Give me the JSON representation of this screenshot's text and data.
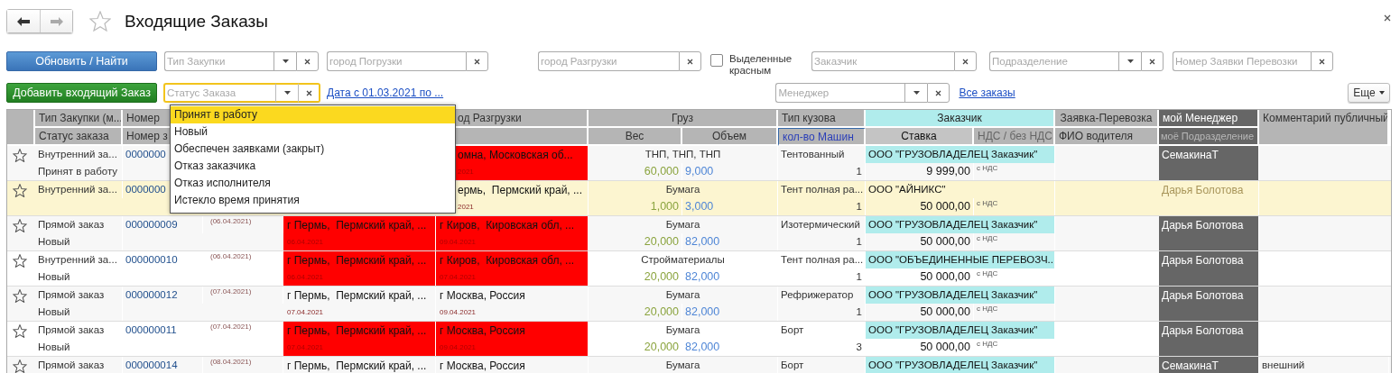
{
  "window": {
    "title": "Входящие Заказы"
  },
  "toolbar": {
    "refresh_button": "Обновить / Найти",
    "add_button": "Добавить входящий Заказ",
    "more_button": "Еще"
  },
  "filters": [
    {
      "kind": "combo",
      "placeholder": "Тип Закупки"
    },
    {
      "kind": "text",
      "placeholder": "город Погрузки"
    },
    {
      "kind": "text",
      "placeholder": "город Разгрузки"
    },
    {
      "kind": "checkbox",
      "label": "Выделенные красным",
      "checked": false
    },
    {
      "kind": "text",
      "placeholder": "Заказчик"
    },
    {
      "kind": "combo",
      "placeholder": "Подразделение"
    },
    {
      "kind": "text",
      "placeholder": "Номер Заявки Перевозки"
    }
  ],
  "status_filter": {
    "placeholder": "Статус Заказа",
    "focused": true
  },
  "date_link": "Дата с 01.03.2021 по ...",
  "manager_filter": {
    "placeholder": "Менеджер"
  },
  "all_orders_link": "Все заказы",
  "status_dropdown": {
    "open": true,
    "options": [
      {
        "label": "Принят в работу",
        "selected": true
      },
      {
        "label": "Новый",
        "selected": false
      },
      {
        "label": "Обеспечен заявками (закрыт)",
        "selected": false
      },
      {
        "label": "Отказ заказчика",
        "selected": false
      },
      {
        "label": "Отказ исполнителя",
        "selected": false
      },
      {
        "label": "Истекло время принятия",
        "selected": false
      }
    ]
  },
  "table": {
    "header_row_1": [
      "Тип Закупки (м...",
      "Номер",
      "од Разгрузки",
      "Груз",
      "Тип кузова",
      "Заказчик",
      "Заявка-Перевозка",
      "мой Менеджер",
      "Комментарий публичный"
    ],
    "header_row_2": [
      "Статус заказа",
      "Номер з",
      "Вес",
      "Объем",
      "кол-во Машин",
      "Ставка",
      "НДС / без НДС",
      "ФИО водителя",
      "моё Подразделение"
    ],
    "rows": [
      {
        "selected": false,
        "type": "Внутренний за...",
        "status": "Принят в работу",
        "number": "0000000",
        "unload": {
          "place": "омна, Московская об...",
          "date": "2021",
          "red": true
        },
        "cargo": "ТНП, ТНП, ТНП",
        "weight": "60,000",
        "volume": "9,000",
        "body": "Тентованный",
        "cars": "1",
        "customer": "ООО \"ГРУЗОВЛАДЕЛЕЦ Заказчик\"",
        "rate": "9 999,00",
        "vat": "с НДС",
        "manager": "СемакинаТ"
      },
      {
        "selected": true,
        "type": "Внутренний за...",
        "number": "0000000",
        "unload": {
          "place": "ермь,  Пермский край, ...",
          "date": "2021",
          "red": false
        },
        "cargo": "Бумага",
        "weight": "1,000",
        "volume": "3,000",
        "body": "Тент полная ра...",
        "cars": "1",
        "customer": "ООО \"АЙНИКС\"",
        "rate": "50 000,00",
        "vat": "с НДС",
        "manager": "Дарья Болотова"
      },
      {
        "selected": false,
        "type": "Прямой заказ",
        "status": "Новый",
        "number": "000000009",
        "date": "(06.04.2021)",
        "load": {
          "place": "г Пермь,  Пермский край, ...",
          "date": "06.04.2021",
          "red": true
        },
        "unload": {
          "place": "г Киров,  Кировская обл, ...",
          "date": "09.04.2021",
          "red": true
        },
        "cargo": "Бумага",
        "weight": "20,000",
        "volume": "82,000",
        "body": "Изотермический",
        "cars": "1",
        "customer": "ООО \"ГРУЗОВЛАДЕЛЕЦ Заказчик\"",
        "rate": "50 000,00",
        "vat": "с НДС",
        "manager": "Дарья Болотова"
      },
      {
        "selected": false,
        "type": "Внутренний за...",
        "status": "Новый",
        "number": "000000010",
        "date": "(06.04.2021)",
        "load": {
          "place": "г Пермь,  Пермский край, ...",
          "date": "06.04.2021",
          "red": true
        },
        "unload": {
          "place": "г Киров,  Кировская обл, ...",
          "date": "07.04.2021",
          "red": true
        },
        "cargo": "Стройматериалы",
        "weight": "20,000",
        "volume": "82,000",
        "body": "Тент полная ра...",
        "cars": "1",
        "customer": "ООО \"ОБЪЕДИНЕННЫЕ ПЕРЕВОЗЧ...",
        "rate": "50 000,00",
        "vat": "с НДС",
        "manager": "Дарья Болотова"
      },
      {
        "selected": false,
        "type": "Прямой заказ",
        "status": "Новый",
        "number": "000000012",
        "date": "(07.04.2021)",
        "load": {
          "place": "г Пермь,  Пермский край, ...",
          "date": "07.04.2021",
          "red": false
        },
        "unload": {
          "place": "г Москва, Россия",
          "date": "09.04.2021",
          "red": false
        },
        "cargo": "Бумага",
        "weight": "20,000",
        "volume": "82,000",
        "body": "Рефрижератор",
        "cars": "1",
        "customer": "ООО \"ГРУЗОВЛАДЕЛЕЦ Заказчик\"",
        "rate": "50 000,00",
        "vat": "с НДС",
        "manager": "Дарья Болотова"
      },
      {
        "selected": false,
        "type": "Прямой заказ",
        "status": "Новый",
        "number": "000000011",
        "date": "(07.04.2021)",
        "load": {
          "place": "г Пермь,  Пермский край, ...",
          "date": "07.04.2021",
          "red": true
        },
        "unload": {
          "place": "г Москва, Россия",
          "date": "09.04.2021",
          "red": true
        },
        "cargo": "Бумага",
        "weight": "20,000",
        "volume": "82,000",
        "body": "Борт",
        "cars": "3",
        "customer": "ООО \"ГРУЗОВЛАДЕЛЕЦ Заказчик\"",
        "rate": "50 000,00",
        "vat": "с НДС",
        "manager": "Дарья Болотова"
      },
      {
        "selected": false,
        "type": "Прямой заказ",
        "number": "000000014",
        "date": "(08.04.2021)",
        "load": {
          "place": "г Пермь,  Пермский край, ...",
          "red": false
        },
        "unload": {
          "place": "г Москва, Россия",
          "red": false
        },
        "cargo": "Бумага",
        "body": "Борт",
        "customer": "ООО \"ГРУЗОВЛАДЕЛЕЦ Заказчик\"",
        "manager": "СемакинаТ",
        "comment": "внешний"
      }
    ]
  }
}
